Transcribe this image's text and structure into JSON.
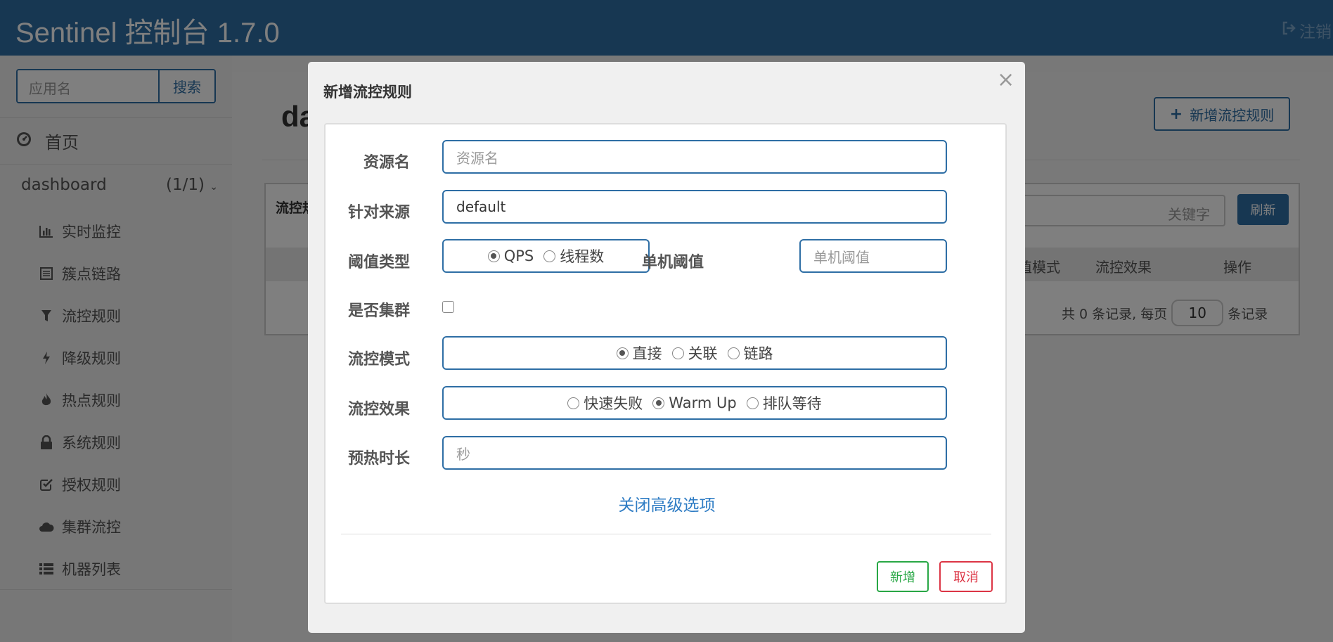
{
  "header": {
    "title": "Sentinel 控制台 1.7.0",
    "logout_label": "注销"
  },
  "sidebar": {
    "search_placeholder": "应用名",
    "search_button": "搜索",
    "home_label": "首页",
    "app_name": "dashboard",
    "app_count": "(1/1)",
    "items": [
      {
        "label": "实时监控",
        "icon": "bar-chart-icon"
      },
      {
        "label": "簇点链路",
        "icon": "list-alt-icon"
      },
      {
        "label": "流控规则",
        "icon": "filter-icon"
      },
      {
        "label": "降级规则",
        "icon": "flash-icon"
      },
      {
        "label": "热点规则",
        "icon": "fire-icon"
      },
      {
        "label": "系统规则",
        "icon": "lock-icon"
      },
      {
        "label": "授权规则",
        "icon": "check-icon"
      },
      {
        "label": "集群流控",
        "icon": "cloud-icon"
      },
      {
        "label": "机器列表",
        "icon": "list-icon"
      }
    ]
  },
  "main": {
    "title": "da",
    "add_rule_button": "新增流控规则",
    "table_title": "流控规",
    "keyword_placeholder": "关键字",
    "refresh_button": "刷新",
    "columns": [
      "值模式",
      "流控效果",
      "操作"
    ],
    "pager": {
      "prefix": "共 0 条记录, 每页",
      "page_size": "10",
      "suffix": "条记录"
    }
  },
  "modal": {
    "title": "新增流控规则",
    "close_symbol": "×",
    "resource": {
      "label": "资源名",
      "placeholder": "资源名"
    },
    "limit_app": {
      "label": "针对来源",
      "value": "default"
    },
    "grade": {
      "label": "阈值类型",
      "options": [
        "QPS",
        "线程数"
      ],
      "selected": "QPS"
    },
    "count": {
      "label": "单机阈值",
      "placeholder": "单机阈值"
    },
    "cluster": {
      "label": "是否集群",
      "checked": false
    },
    "strategy": {
      "label": "流控模式",
      "options": [
        "直接",
        "关联",
        "链路"
      ],
      "selected": "直接"
    },
    "control_behavior": {
      "label": "流控效果",
      "options": [
        "快速失败",
        "Warm Up",
        "排队等待"
      ],
      "selected": "Warm Up"
    },
    "warmup": {
      "label": "预热时长",
      "placeholder": "秒"
    },
    "advanced_toggle": "关闭高级选项",
    "add_button": "新增",
    "cancel_button": "取消"
  }
}
